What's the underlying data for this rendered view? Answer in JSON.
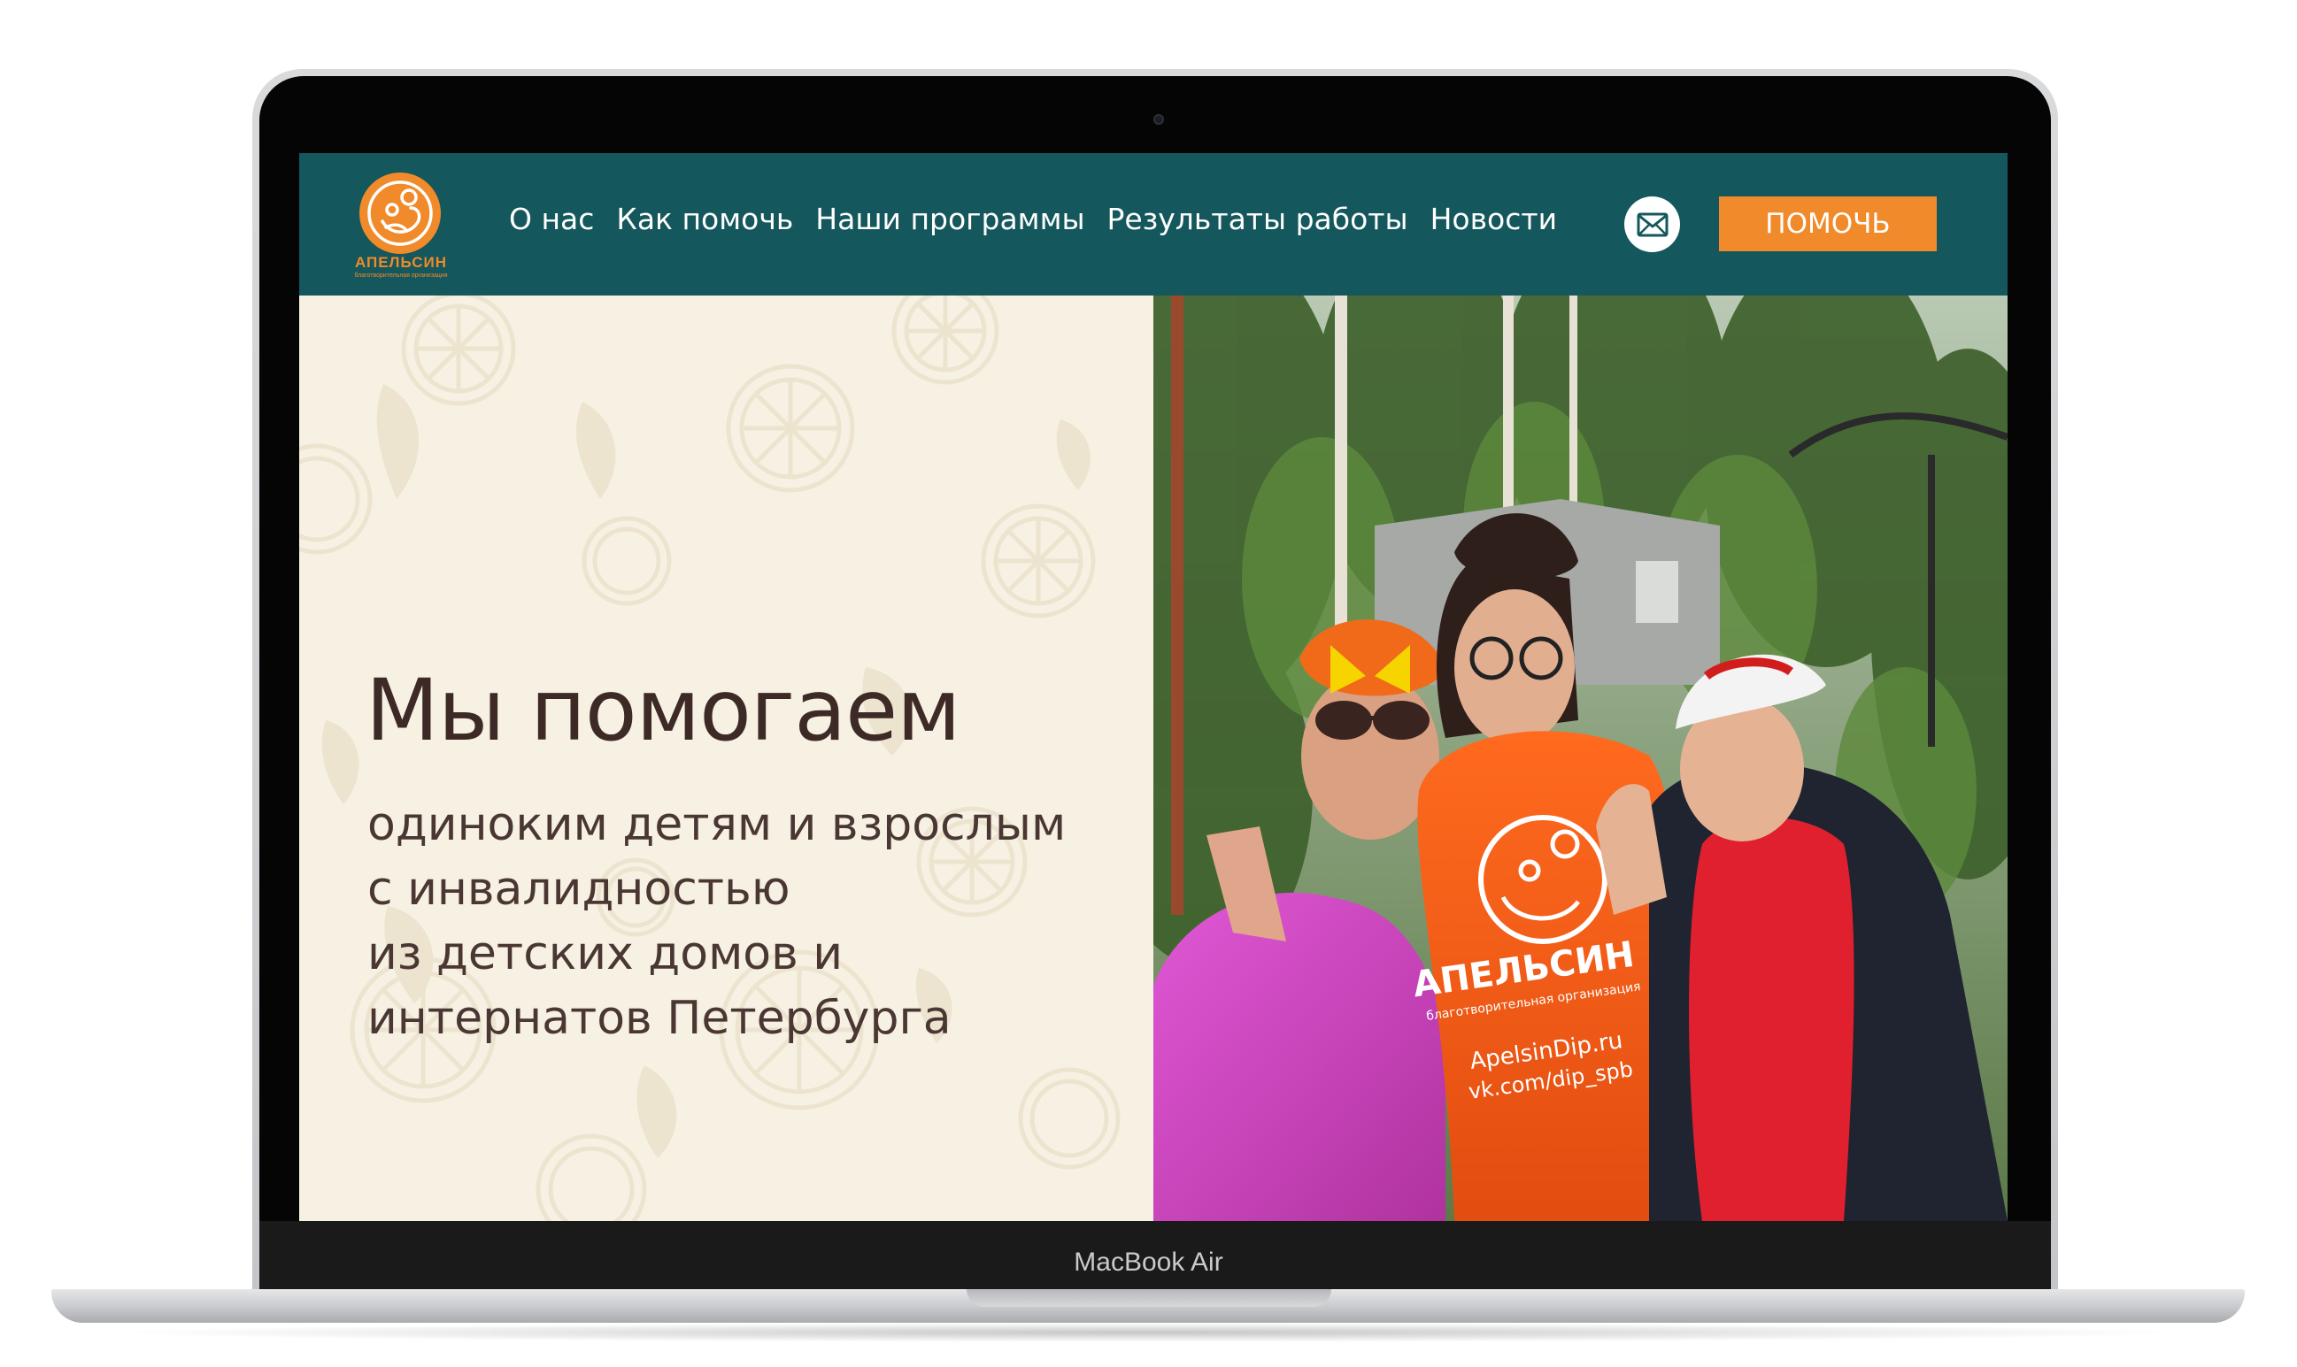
{
  "device": {
    "brand_label": "MacBook Air"
  },
  "header": {
    "logo": {
      "name": "АПЕЛЬСИН",
      "subtitle": "благотворительная организация"
    },
    "nav": [
      {
        "label": "О нас"
      },
      {
        "label": "Как помочь"
      },
      {
        "label": "Наши программы"
      },
      {
        "label": "Результаты работы"
      },
      {
        "label": "Новости"
      }
    ],
    "mail_icon": "envelope-icon",
    "help_button": "ПОМОЧЬ"
  },
  "hero": {
    "title": "Мы помогаем",
    "lines": [
      "одиноким детям и взрослым",
      "с инвалидностью",
      "из детских домов и",
      "интернатов Петербурга"
    ],
    "photo": {
      "shirt_name": "АПЕЛЬСИН",
      "shirt_sub": "благотворительная организация",
      "shirt_site": "ApelsinDip.ru",
      "shirt_vk": "vk.com/dip_spb"
    }
  },
  "colors": {
    "header_bg": "#14575c",
    "accent": "#f08a2a",
    "hero_bg": "#f6f1e2",
    "text": "#3d2a26"
  }
}
